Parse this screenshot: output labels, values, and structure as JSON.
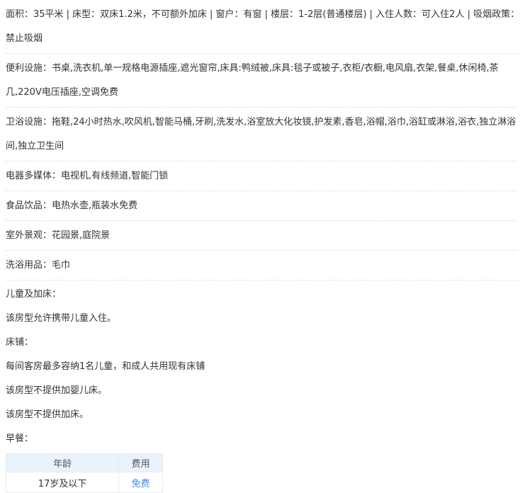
{
  "room_info": {
    "area_line_1": "面积：35平米 | 床型：双床1.2米，不可额外加床 | 窗户：有窗 | 楼层：1-2层(普通楼层) | 入住人数：可入住2人 | 吸烟政策：",
    "area_line_2": "禁止吸烟"
  },
  "amenities": {
    "convenience_line_1": "便利设施：书桌,洗衣机,单一规格电源插座,遮光窗帘,床具:鸭绒被,床具:毯子或被子,衣柜/衣橱,电风扇,衣架,餐桌,休闲椅,茶",
    "convenience_line_2": "几,220V电压插座,空调免费",
    "bathroom_line_1": "卫浴设施：拖鞋,24小时热水,吹风机,智能马桶,牙刷,洗发水,浴室放大化妆镜,护发素,香皂,浴帽,浴巾,浴缸或淋浴,浴衣,独立淋浴",
    "bathroom_line_2": "间,独立卫生间",
    "media": "电器多媒体：电视机,有线频道,智能门锁",
    "food": "食品饮品：电热水壶,瓶装水免费",
    "view": "室外景观：花园景,庭院景",
    "toiletries": "洗浴用品：毛巾"
  },
  "policy": {
    "children_title": "儿童及加床：",
    "children_text": "该房型允许携带儿童入住。",
    "bedding_title": "床铺：",
    "bedding_text_1": "每间客房最多容纳1名儿童，和成人共用现有床铺",
    "bedding_text_2": "该房型不提供加婴儿床。",
    "bedding_text_3": "该房型不提供加床。",
    "breakfast_title": "早餐："
  },
  "breakfast_table": {
    "headers": [
      "年龄",
      "费用"
    ],
    "rows": [
      [
        "17岁及以下",
        "免费"
      ]
    ]
  },
  "colors": {
    "free_text": "#3a8ee6",
    "table_header_bg": "#eaf3fc"
  }
}
